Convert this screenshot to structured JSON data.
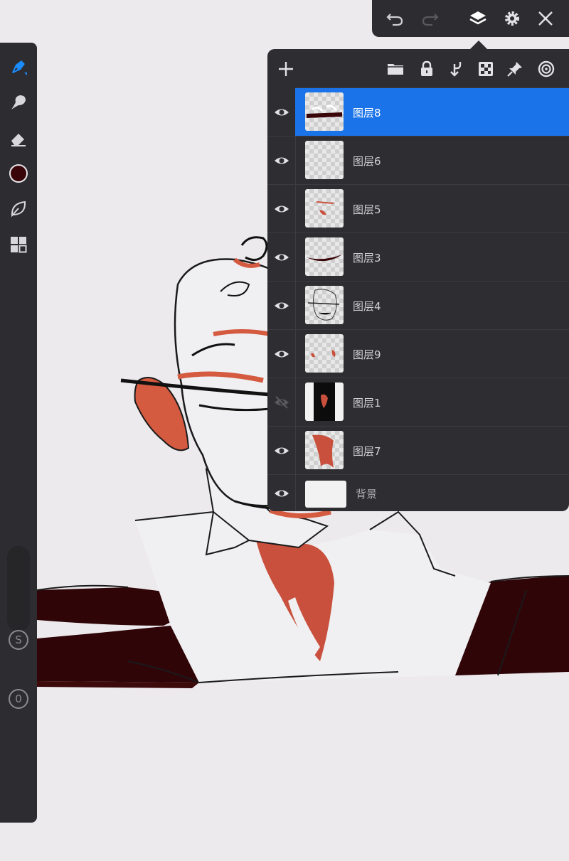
{
  "toolbar": {
    "undo_icon": "undo-icon",
    "redo_icon": "redo-icon",
    "layers_icon": "layers-icon",
    "settings_icon": "gear-icon",
    "close_icon": "close-icon"
  },
  "tools": {
    "brush": "brush-icon",
    "smudge": "smudge-icon",
    "eraser": "eraser-icon",
    "color": "#3a0508",
    "leaf": "leaf-icon",
    "grid": "grid-icon",
    "size_label": "S",
    "opacity_label": "0",
    "accent": "#1a8cff"
  },
  "layers_panel": {
    "header_icons": [
      "add-icon",
      "folder-icon",
      "lock-icon",
      "merge-down-icon",
      "checker-icon",
      "pin-icon",
      "target-icon"
    ],
    "layers": [
      {
        "name": "图层8",
        "visible": true,
        "selected": true
      },
      {
        "name": "图层6",
        "visible": true
      },
      {
        "name": "图层5",
        "visible": true
      },
      {
        "name": "图层3",
        "visible": true
      },
      {
        "name": "图层4",
        "visible": true
      },
      {
        "name": "图层9",
        "visible": true
      },
      {
        "name": "图层1",
        "visible": false
      },
      {
        "name": "图层7",
        "visible": true
      }
    ],
    "background": {
      "name": "背景",
      "visible": true
    }
  }
}
